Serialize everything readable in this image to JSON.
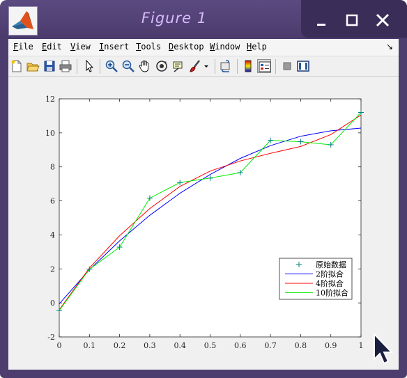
{
  "window": {
    "title": "Figure 1",
    "minimize_icon": "minimize-icon",
    "maximize_icon": "maximize-icon",
    "close_icon": "close-icon",
    "accent": "#4d3d6e",
    "title_color": "#d9b8ff"
  },
  "menubar": {
    "items": [
      {
        "label": "File"
      },
      {
        "label": "Edit"
      },
      {
        "label": "View"
      },
      {
        "label": "Insert"
      },
      {
        "label": "Tools"
      },
      {
        "label": "Desktop"
      },
      {
        "label": "Window"
      },
      {
        "label": "Help"
      }
    ],
    "overflow_arrow": "↘"
  },
  "toolbar": {
    "buttons": [
      {
        "name": "new-figure-icon"
      },
      {
        "name": "open-file-icon"
      },
      {
        "name": "save-icon"
      },
      {
        "name": "print-icon"
      },
      {
        "name": "edit-plot-arrow-icon"
      },
      {
        "name": "zoom-in-icon"
      },
      {
        "name": "zoom-out-icon"
      },
      {
        "name": "pan-hand-icon"
      },
      {
        "name": "rotate-3d-icon"
      },
      {
        "name": "data-cursor-icon"
      },
      {
        "name": "brush-icon"
      },
      {
        "name": "brush-dropdown-icon"
      },
      {
        "name": "link-plot-icon"
      },
      {
        "name": "colorbar-icon"
      },
      {
        "name": "legend-icon"
      },
      {
        "name": "hide-plot-tools-icon"
      },
      {
        "name": "show-plot-tools-icon"
      }
    ]
  },
  "chart_data": {
    "type": "line",
    "title": "",
    "xlabel": "",
    "ylabel": "",
    "xlim": [
      0,
      1
    ],
    "ylim": [
      -2,
      12
    ],
    "xticks": [
      "0",
      "0.1",
      "0.2",
      "0.3",
      "0.4",
      "0.5",
      "0.6",
      "0.7",
      "0.8",
      "0.9",
      "1"
    ],
    "yticks": [
      "-2",
      "0",
      "2",
      "4",
      "6",
      "8",
      "10",
      "12"
    ],
    "grid": false,
    "legend_position": "lower-right",
    "x": [
      0,
      0.1,
      0.2,
      0.3,
      0.4,
      0.5,
      0.6,
      0.7,
      0.8,
      0.9,
      1.0
    ],
    "series": [
      {
        "name": "原始数据",
        "style": "markers-plus",
        "color": "#008080",
        "values": [
          -0.45,
          1.98,
          3.28,
          6.16,
          7.08,
          7.34,
          7.66,
          9.56,
          9.48,
          9.3,
          11.2
        ]
      },
      {
        "name": "2阶拟合",
        "style": "line",
        "color": "#0000ff",
        "values": [
          -0.05,
          1.95,
          3.65,
          5.15,
          6.45,
          7.55,
          8.5,
          9.25,
          9.8,
          10.12,
          10.28
        ]
      },
      {
        "name": "4阶拟合",
        "style": "line",
        "color": "#ff0000",
        "values": [
          -0.4,
          2.05,
          3.95,
          5.55,
          6.85,
          7.75,
          8.35,
          8.8,
          9.2,
          9.9,
          11.05
        ]
      },
      {
        "name": "10阶拟合",
        "style": "line",
        "color": "#00ee00",
        "values": [
          -0.45,
          1.98,
          3.28,
          6.16,
          7.08,
          7.34,
          7.66,
          9.56,
          9.48,
          9.3,
          11.2
        ]
      }
    ]
  }
}
